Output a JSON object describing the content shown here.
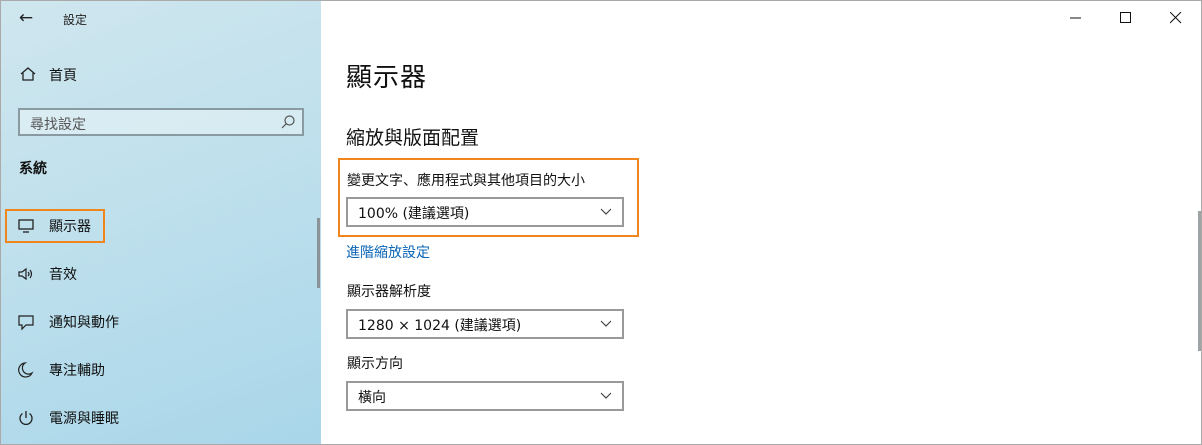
{
  "window": {
    "app_title": "設定"
  },
  "sidebar": {
    "home_label": "首頁",
    "search_placeholder": "尋找設定",
    "section_title": "系統",
    "items": [
      {
        "label": "顯示器",
        "icon": "monitor-icon",
        "selected": true
      },
      {
        "label": "音效",
        "icon": "speaker-icon"
      },
      {
        "label": "通知與動作",
        "icon": "notification-icon"
      },
      {
        "label": "專注輔助",
        "icon": "moon-icon"
      },
      {
        "label": "電源與睡眠",
        "icon": "power-icon"
      }
    ]
  },
  "main": {
    "title": "顯示器",
    "subheading": "縮放與版面配置",
    "scale": {
      "label": "變更文字、應用程式與其他項目的大小",
      "value": "100% (建議選項)"
    },
    "advanced_link": "進階縮放設定",
    "resolution": {
      "label": "顯示器解析度",
      "value": "1280 × 1024 (建議選項)"
    },
    "orientation": {
      "label": "顯示方向",
      "value": "橫向"
    }
  },
  "colors": {
    "highlight": "#f0851c",
    "link": "#0a66b7"
  }
}
